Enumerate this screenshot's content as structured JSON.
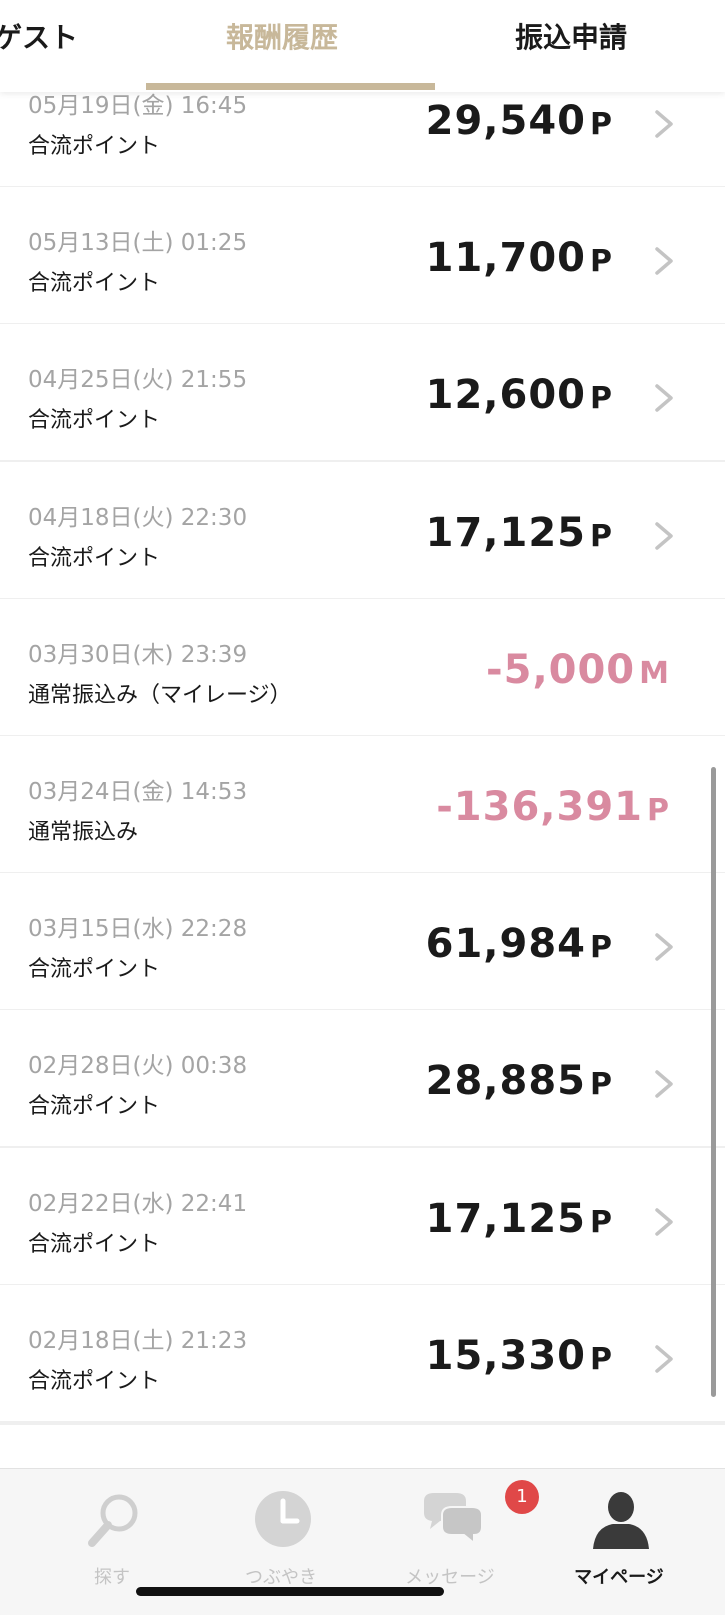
{
  "tabs": {
    "left": "ゲスト",
    "center": "報酬履歴",
    "right": "振込申請"
  },
  "history": [
    {
      "date": "05月19日(金) 16:45",
      "label": "合流ポイント",
      "amount": "29,540",
      "unit": "P",
      "type": "credit"
    },
    {
      "date": "05月13日(土) 01:25",
      "label": "合流ポイント",
      "amount": "11,700",
      "unit": "P",
      "type": "credit"
    },
    {
      "date": "04月25日(火) 21:55",
      "label": "合流ポイント",
      "amount": "12,600",
      "unit": "P",
      "type": "credit"
    },
    {
      "date": "04月18日(火) 22:30",
      "label": "合流ポイント",
      "amount": "17,125",
      "unit": "P",
      "type": "credit"
    },
    {
      "date": "03月30日(木) 23:39",
      "label": "通常振込み（マイレージ）",
      "amount": "-5,000",
      "unit": "M",
      "type": "debit"
    },
    {
      "date": "03月24日(金) 14:53",
      "label": "通常振込み",
      "amount": "-136,391",
      "unit": "P",
      "type": "debit"
    },
    {
      "date": "03月15日(水) 22:28",
      "label": "合流ポイント",
      "amount": "61,984",
      "unit": "P",
      "type": "credit"
    },
    {
      "date": "02月28日(火) 00:38",
      "label": "合流ポイント",
      "amount": "28,885",
      "unit": "P",
      "type": "credit"
    },
    {
      "date": "02月22日(水) 22:41",
      "label": "合流ポイント",
      "amount": "17,125",
      "unit": "P",
      "type": "credit"
    },
    {
      "date": "02月18日(土) 21:23",
      "label": "合流ポイント",
      "amount": "15,330",
      "unit": "P",
      "type": "credit"
    }
  ],
  "nav": [
    {
      "label": "探す",
      "icon": "search-icon"
    },
    {
      "label": "つぶやき",
      "icon": "clock-icon"
    },
    {
      "label": "メッセージ",
      "icon": "chat-icon"
    },
    {
      "label": "マイページ",
      "icon": "person-icon"
    }
  ],
  "badge": {
    "count": "1"
  },
  "colors": {
    "accent": "#c8b89a",
    "negative": "#d98aa0",
    "badge": "#e04848"
  }
}
